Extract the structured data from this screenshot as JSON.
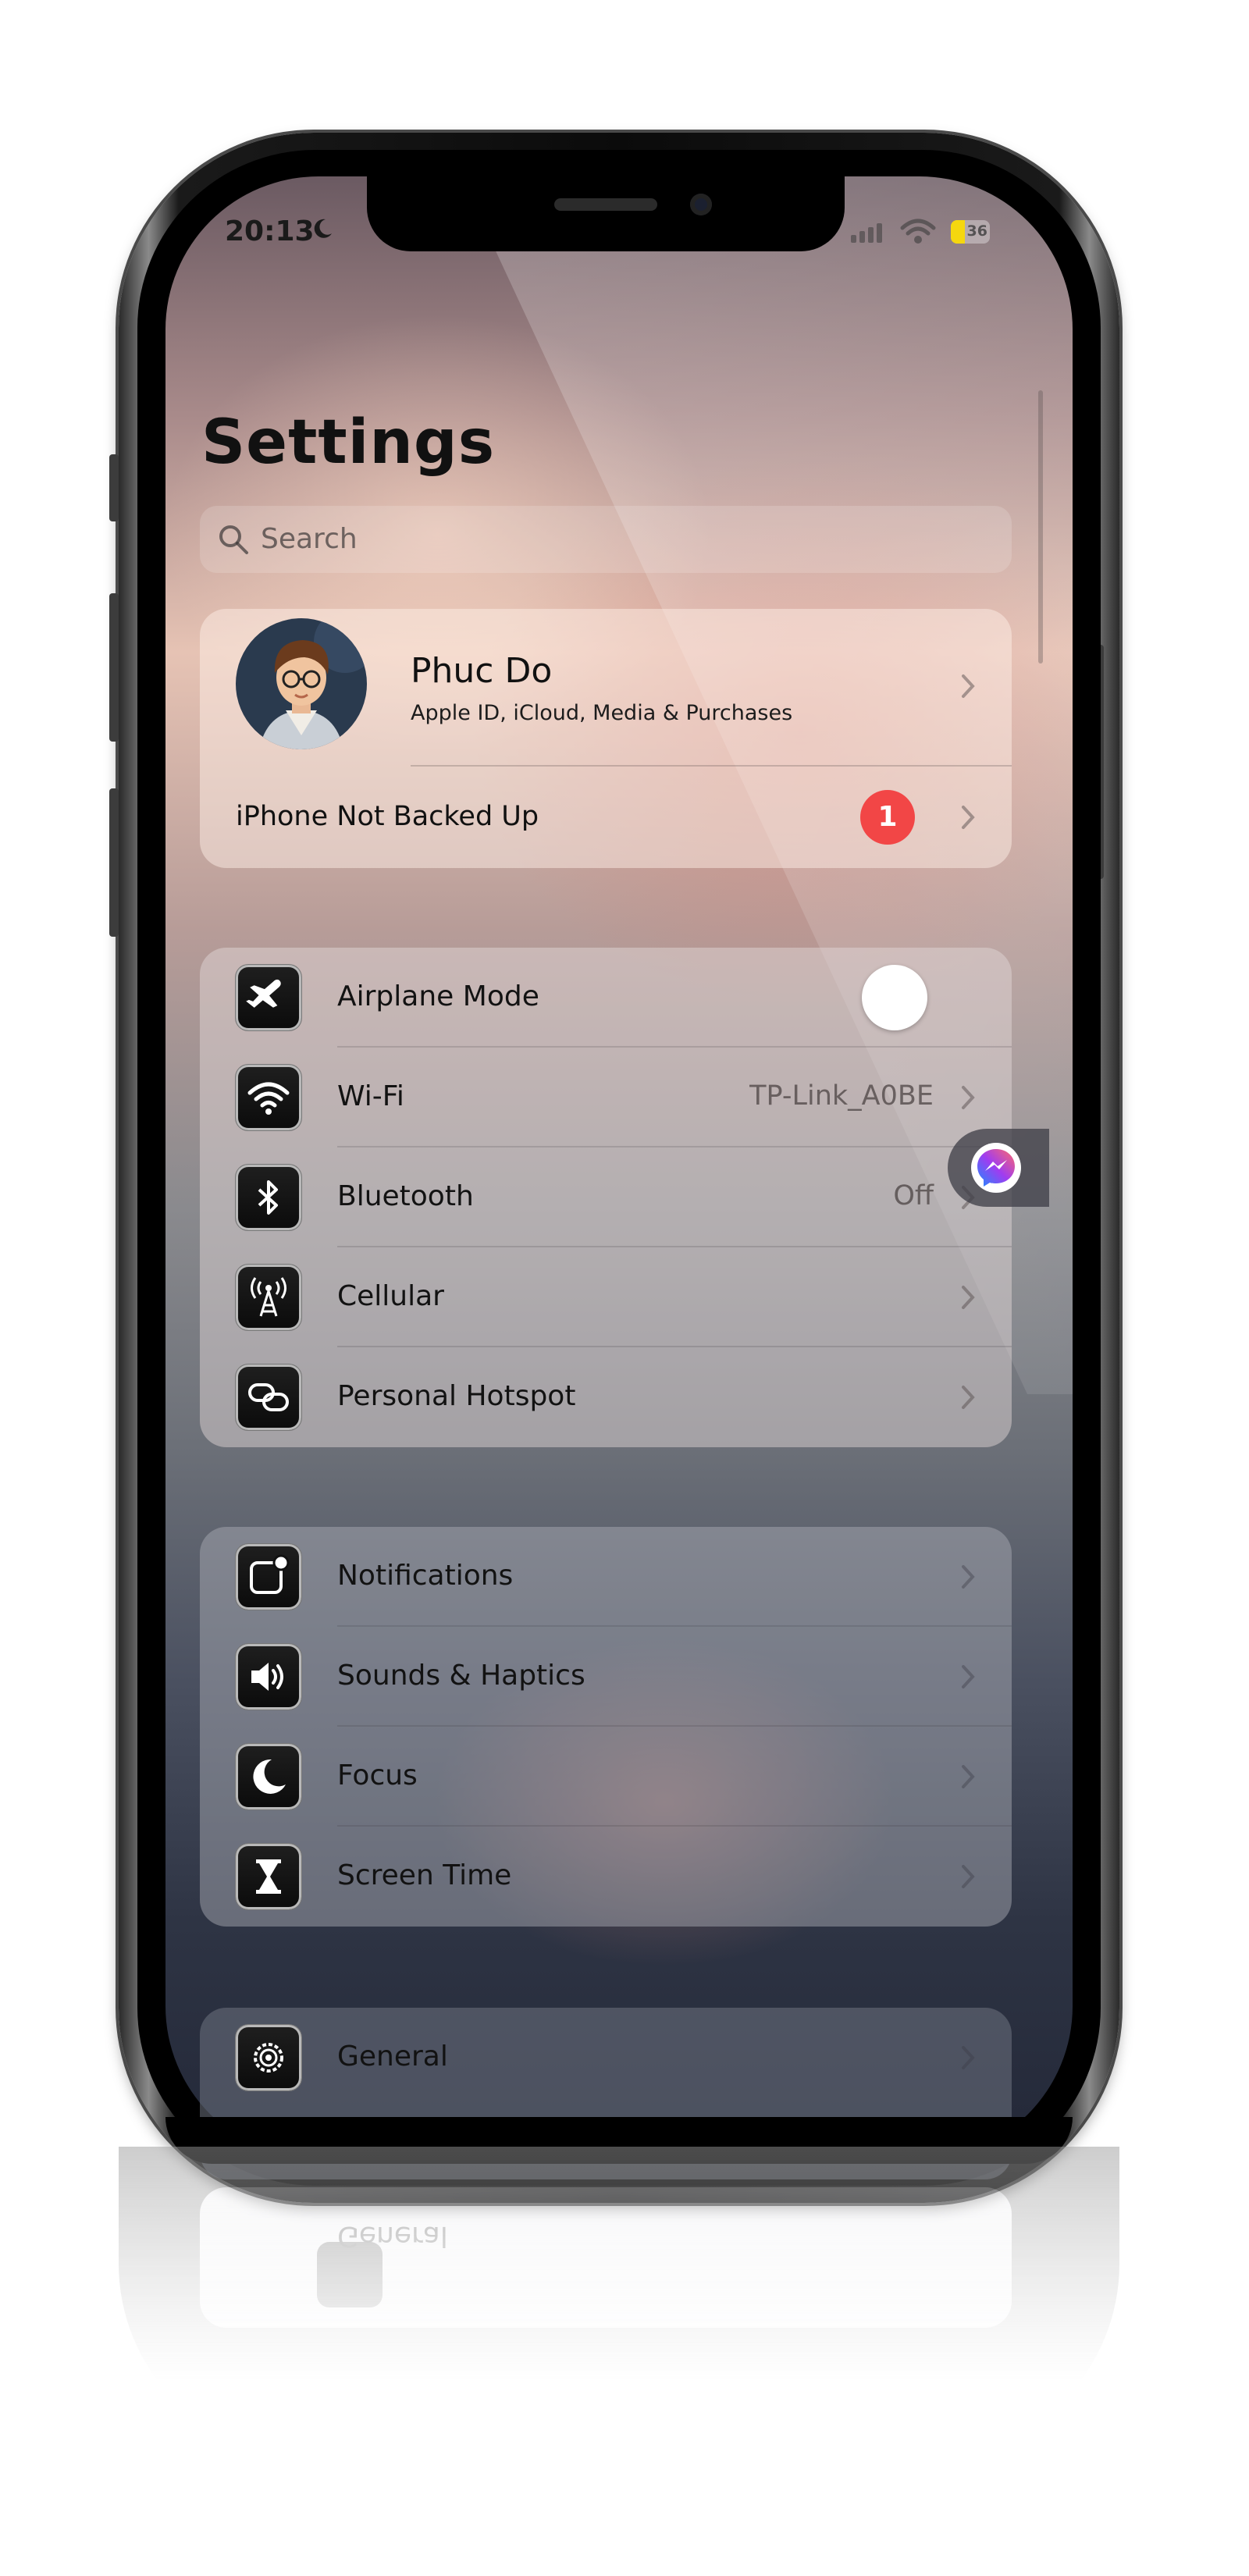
{
  "status_bar": {
    "time": "20:13",
    "battery": "36",
    "battery_level": 0.36
  },
  "header": {
    "title": "Settings"
  },
  "search": {
    "placeholder": "Search"
  },
  "profile": {
    "name": "Phuc Do",
    "subtitle": "Apple ID, iCloud, Media & Purchases",
    "backup_label": "iPhone Not Backed Up",
    "backup_badge": "1"
  },
  "network_group": [
    {
      "label": "Airplane Mode",
      "icon": "airplane-icon",
      "toggle": false
    },
    {
      "label": "Wi-Fi",
      "value": "TP-Link_A0BE",
      "icon": "wifi-icon"
    },
    {
      "label": "Bluetooth",
      "value": "Off",
      "icon": "bluetooth-icon"
    },
    {
      "label": "Cellular",
      "icon": "cellular-tower-icon"
    },
    {
      "label": "Personal Hotspot",
      "icon": "hotspot-link-icon"
    }
  ],
  "notifications_group": [
    {
      "label": "Notifications",
      "icon": "notification-badge-icon"
    },
    {
      "label": "Sounds & Haptics",
      "icon": "speaker-icon"
    },
    {
      "label": "Focus",
      "icon": "moon-icon"
    },
    {
      "label": "Screen Time",
      "icon": "hourglass-icon"
    }
  ],
  "general_group": [
    {
      "label": "General",
      "icon": "gear-icon"
    }
  ],
  "reflection": {
    "label": "General"
  },
  "colors": {
    "badge": "#f24646",
    "battery": "#f5d70f",
    "messenger": "#a03cf0"
  }
}
